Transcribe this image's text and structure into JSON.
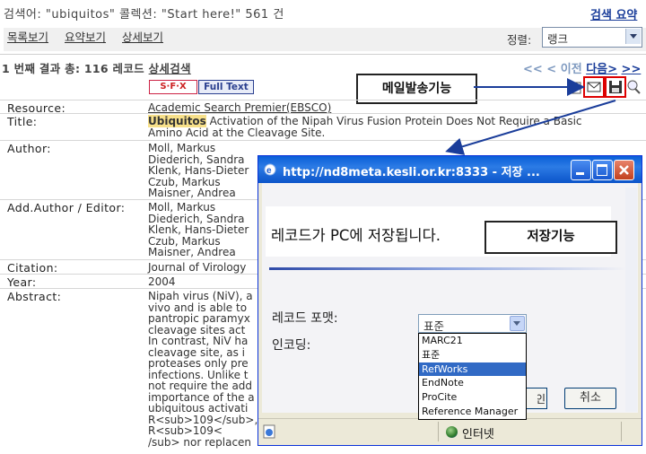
{
  "header": {
    "search_text": "검색어: \"ubiquitos\" 콜렉션: \"Start here!\" 561 건",
    "summary_link": "검색 요약"
  },
  "tabs": [
    "목록보기",
    "요약보기",
    "상세보기"
  ],
  "sort": {
    "label": "정렬:",
    "value": "랭크"
  },
  "results": {
    "line_prefix": "1 번째 결과 총: 116 레코드",
    "detail_search": "상세검색",
    "prev": "<<  < 이전",
    "next": "다음>",
    "last": ">>"
  },
  "buttons": {
    "sfx": "S·F·X",
    "full_text": "Full Text"
  },
  "record": {
    "resource_label": "Resource:",
    "resource": "Academic Search Premier(EBSCO)",
    "title_label": "Title:",
    "title_highlight": "Ubiquitos",
    "title_rest": " Activation of the Nipah Virus Fusion Protein Does Not Require a Basic",
    "title_line2": "Amino Acid at the Cleavage Site.",
    "author_label": "Author:",
    "authors": "Moll, Markus\nDiederich, Sandra\nKlenk, Hans-Dieter\nCzub, Markus\nMaisner, Andrea",
    "add_author_label": "Add.Author / Editor:",
    "add_authors": "Moll, Markus\nDiederich, Sandra\nKlenk, Hans-Dieter\nCzub, Markus\nMaisner, Andrea",
    "citation_label": "Citation:",
    "citation": "Journal of Virology",
    "year_label": "Year:",
    "year": "2004",
    "abstract_label": "Abstract:",
    "abstract": "Nipah virus (NiV), a\nvivo and is able to\npantropic paramyx\ncleavage sites act\nIn contrast, NiV ha\ncleavage site, as i\nproteases only pre\ninfections. Unlike t\nnot require the add\nimportance of the a\nubiquitous activati\nR<sub>109</sub>,\nR<sub>109<\n/sub> nor replacen"
  },
  "callouts": {
    "mail": "메일발송기능",
    "save": "저장기능"
  },
  "popup": {
    "title": "http://nd8meta.kesli.or.kr:8333 - 저장 ...",
    "message": "레코드가 PC에 저장됩니다.",
    "format_label": "레코드 포맷:",
    "encoding_label": "인코딩:",
    "format_value": "표준",
    "format_options": [
      "MARC21",
      "표준",
      "RefWorks",
      "EndNote",
      "ProCite",
      "Reference Manager"
    ],
    "ok_button": "확인",
    "cancel_button": "취소",
    "status_zone": "인터넷"
  },
  "colors": {
    "accent": "#1a3d9a",
    "highlight": "#f7e08a",
    "popup_title": "#0a5fd8",
    "callout_arrow": "#1a3d9a"
  }
}
